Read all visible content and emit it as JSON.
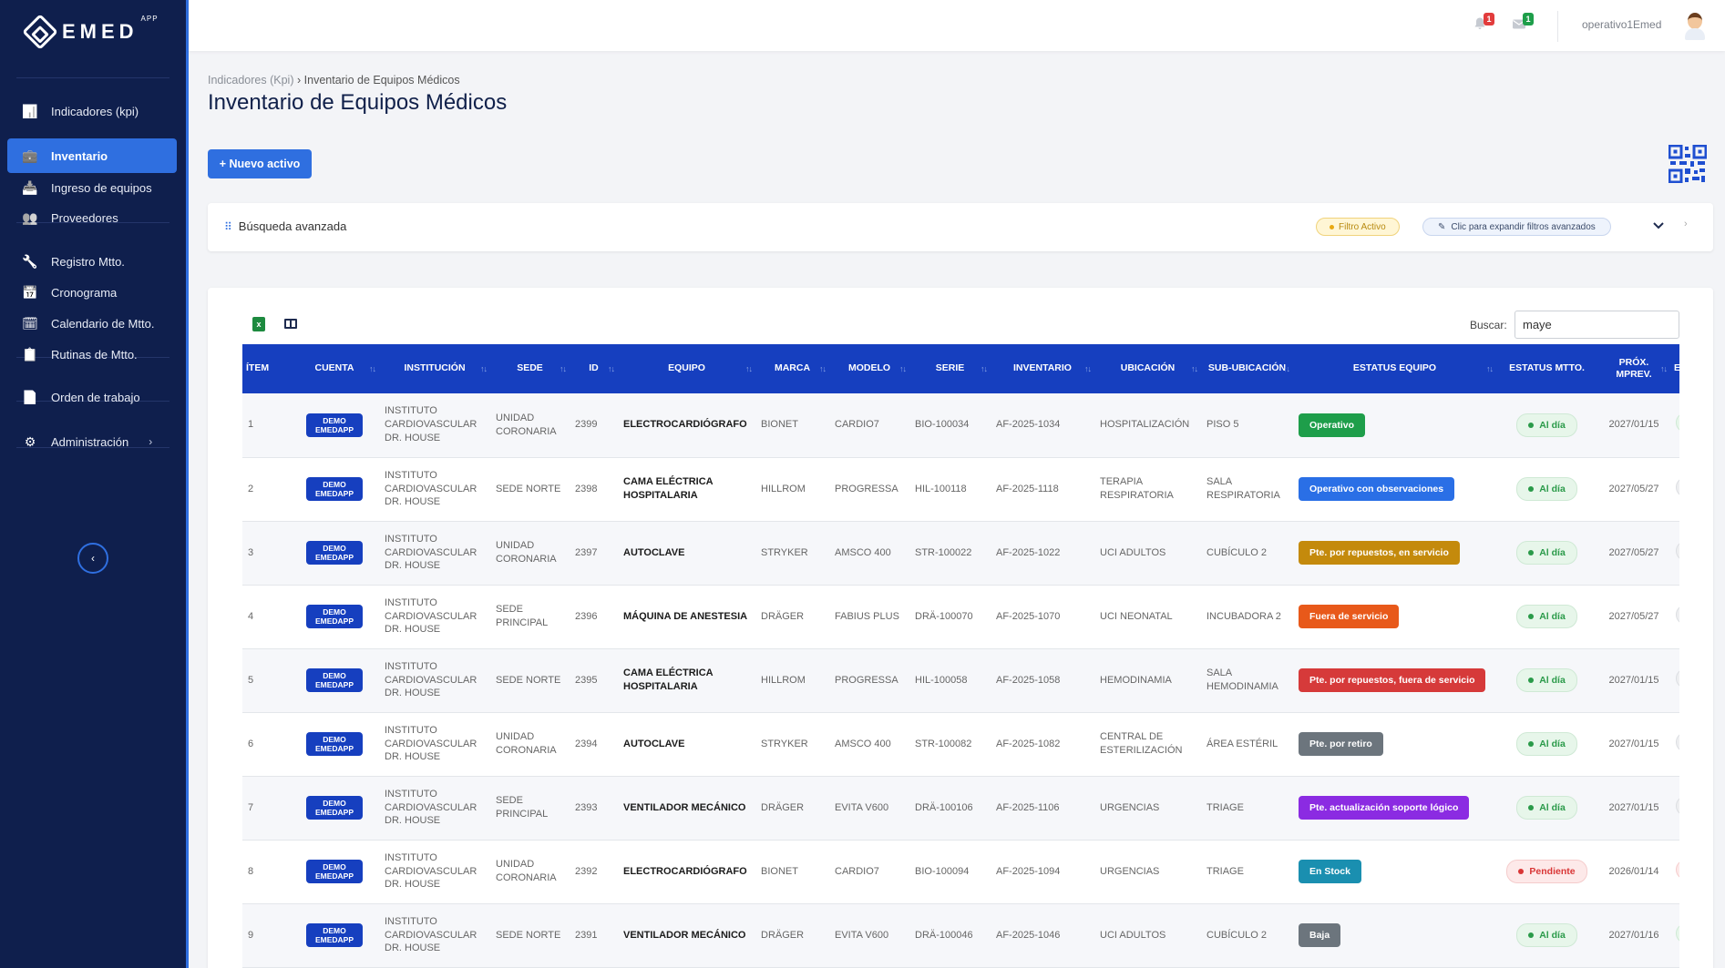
{
  "app": {
    "logo_text": "EMED",
    "logo_sup": "APP"
  },
  "sidebar": {
    "items": [
      {
        "label": "Indicadores (kpi)",
        "icon": "chart-icon"
      },
      {
        "label": "Inventario",
        "icon": "briefcase-icon",
        "active": true
      },
      {
        "label": "Ingreso de equipos",
        "icon": "inbox-icon"
      },
      {
        "label": "Proveedores",
        "icon": "users-icon"
      },
      {
        "label": "Registro Mtto.",
        "icon": "wrench-icon"
      },
      {
        "label": "Cronograma",
        "icon": "calendar-grid-icon"
      },
      {
        "label": "Calendario de Mtto.",
        "icon": "calendar-check-icon"
      },
      {
        "label": "Rutinas de Mtto.",
        "icon": "clipboard-icon"
      },
      {
        "label": "Orden de trabajo",
        "icon": "document-icon"
      },
      {
        "label": "Administración",
        "icon": "gear-icon"
      }
    ],
    "collapse_glyph": "‹"
  },
  "topbar": {
    "notifications_count": "1",
    "messages_count": "1",
    "username": "operativo1Emed"
  },
  "header": {
    "breadcrumb_root": "Indicadores (Kpi)",
    "breadcrumb_sep": "›",
    "breadcrumb_current": "Inventario de Equipos Médicos",
    "title": "Inventario de Equipos Médicos",
    "new_button": "+ Nuevo activo"
  },
  "advanced_search": {
    "title": "Búsqueda avanzada",
    "filter_badge": "Filtro Activo",
    "expand_badge": "Clic para expandir filtros avanzados"
  },
  "table_tools": {
    "search_label": "Buscar:",
    "search_value": "maye"
  },
  "table": {
    "columns": [
      "ÍTEM",
      "CUENTA",
      "INSTITUCIÓN",
      "SEDE",
      "ID",
      "EQUIPO",
      "MARCA",
      "MODELO",
      "SERIE",
      "INVENTARIO",
      "UBICACIÓN",
      "SUB-UBICACIÓN",
      "ESTATUS EQUIPO",
      "ESTATUS MTTO.",
      "PRÓX. MPREV.",
      "ESTA"
    ],
    "rows": [
      {
        "item": "1",
        "account": "DEMO EMEDAPP",
        "institution": "INSTITUTO CARDIOVASCULAR DR. HOUSE",
        "site": "UNIDAD CORONARIA",
        "id": "2399",
        "equipment": "ELECTROCARDIÓGRAFO",
        "brand": "BIONET",
        "model": "CARDIO7",
        "serial": "BIO-100034",
        "inventory": "AF-2025-1034",
        "location": "HOSPITALIZACIÓN",
        "sublocation": "PISO 5",
        "status": "Operativo",
        "status_color": "#1e9e4a",
        "mtto": "Al día",
        "mtto_type": "ok",
        "next": "2027/01/15"
      },
      {
        "item": "2",
        "account": "DEMO EMEDAPP",
        "institution": "INSTITUTO CARDIOVASCULAR DR. HOUSE",
        "site": "SEDE NORTE",
        "id": "2398",
        "equipment": "CAMA ELÉCTRICA HOSPITALARIA",
        "brand": "HILLROM",
        "model": "PROGRESSA",
        "serial": "HIL-100118",
        "inventory": "AF-2025-1118",
        "location": "TERAPIA RESPIRATORIA",
        "sublocation": "SALA RESPIRATORIA",
        "status": "Operativo con observaciones",
        "status_color": "#2a6fe6",
        "mtto": "Al día",
        "mtto_type": "ok",
        "next": "2027/05/27"
      },
      {
        "item": "3",
        "account": "DEMO EMEDAPP",
        "institution": "INSTITUTO CARDIOVASCULAR DR. HOUSE",
        "site": "UNIDAD CORONARIA",
        "id": "2397",
        "equipment": "AUTOCLAVE",
        "brand": "STRYKER",
        "model": "AMSCO 400",
        "serial": "STR-100022",
        "inventory": "AF-2025-1022",
        "location": "UCI ADULTOS",
        "sublocation": "CUBÍCULO 2",
        "status": "Pte. por repuestos, en servicio",
        "status_color": "#c48a0c",
        "mtto": "Al día",
        "mtto_type": "ok",
        "next": "2027/05/27"
      },
      {
        "item": "4",
        "account": "DEMO EMEDAPP",
        "institution": "INSTITUTO CARDIOVASCULAR DR. HOUSE",
        "site": "SEDE PRINCIPAL",
        "id": "2396",
        "equipment": "MÁQUINA DE ANESTESIA",
        "brand": "DRÄGER",
        "model": "FABIUS PLUS",
        "serial": "DRÄ-100070",
        "inventory": "AF-2025-1070",
        "location": "UCI NEONATAL",
        "sublocation": "INCUBADORA 2",
        "status": "Fuera de servicio",
        "status_color": "#e8591a",
        "mtto": "Al día",
        "mtto_type": "ok",
        "next": "2027/05/27"
      },
      {
        "item": "5",
        "account": "DEMO EMEDAPP",
        "institution": "INSTITUTO CARDIOVASCULAR DR. HOUSE",
        "site": "SEDE NORTE",
        "id": "2395",
        "equipment": "CAMA ELÉCTRICA HOSPITALARIA",
        "brand": "HILLROM",
        "model": "PROGRESSA",
        "serial": "HIL-100058",
        "inventory": "AF-2025-1058",
        "location": "HEMODINAMIA",
        "sublocation": "SALA HEMODINAMIA",
        "status": "Pte. por repuestos, fuera de servicio",
        "status_color": "#d63a3a",
        "mtto": "Al día",
        "mtto_type": "ok",
        "next": "2027/01/15"
      },
      {
        "item": "6",
        "account": "DEMO EMEDAPP",
        "institution": "INSTITUTO CARDIOVASCULAR DR. HOUSE",
        "site": "UNIDAD CORONARIA",
        "id": "2394",
        "equipment": "AUTOCLAVE",
        "brand": "STRYKER",
        "model": "AMSCO 400",
        "serial": "STR-100082",
        "inventory": "AF-2025-1082",
        "location": "CENTRAL DE ESTERILIZACIÓN",
        "sublocation": "ÁREA ESTÉRIL",
        "status": "Pte. por retiro",
        "status_color": "#6c757d",
        "mtto": "Al día",
        "mtto_type": "ok",
        "next": "2027/01/15"
      },
      {
        "item": "7",
        "account": "DEMO EMEDAPP",
        "institution": "INSTITUTO CARDIOVASCULAR DR. HOUSE",
        "site": "SEDE PRINCIPAL",
        "id": "2393",
        "equipment": "VENTILADOR MECÁNICO",
        "brand": "DRÄGER",
        "model": "EVITA V600",
        "serial": "DRÄ-100106",
        "inventory": "AF-2025-1106",
        "location": "URGENCIAS",
        "sublocation": "TRIAGE",
        "status": "Pte. actualización soporte lógico",
        "status_color": "#8b2be2",
        "mtto": "Al día",
        "mtto_type": "ok",
        "next": "2027/01/15"
      },
      {
        "item": "8",
        "account": "DEMO EMEDAPP",
        "institution": "INSTITUTO CARDIOVASCULAR DR. HOUSE",
        "site": "UNIDAD CORONARIA",
        "id": "2392",
        "equipment": "ELECTROCARDIÓGRAFO",
        "brand": "BIONET",
        "model": "CARDIO7",
        "serial": "BIO-100094",
        "inventory": "AF-2025-1094",
        "location": "URGENCIAS",
        "sublocation": "TRIAGE",
        "status": "En Stock",
        "status_color": "#1a8fb0",
        "mtto": "Pendiente",
        "mtto_type": "pend",
        "next": "2026/01/14"
      },
      {
        "item": "9",
        "account": "DEMO EMEDAPP",
        "institution": "INSTITUTO CARDIOVASCULAR DR. HOUSE",
        "site": "SEDE NORTE",
        "id": "2391",
        "equipment": "VENTILADOR MECÁNICO",
        "brand": "DRÄGER",
        "model": "EVITA V600",
        "serial": "DRÄ-100046",
        "inventory": "AF-2025-1046",
        "location": "UCI ADULTOS",
        "sublocation": "CUBÍCULO 2",
        "status": "Baja",
        "status_color": "#6c757d",
        "mtto": "Al día",
        "mtto_type": "ok",
        "next": "2027/01/16"
      }
    ]
  },
  "colors": {
    "sidebar_bg": "#0f1f4d",
    "accent": "#2f6fe0",
    "table_header": "#163fbf"
  }
}
